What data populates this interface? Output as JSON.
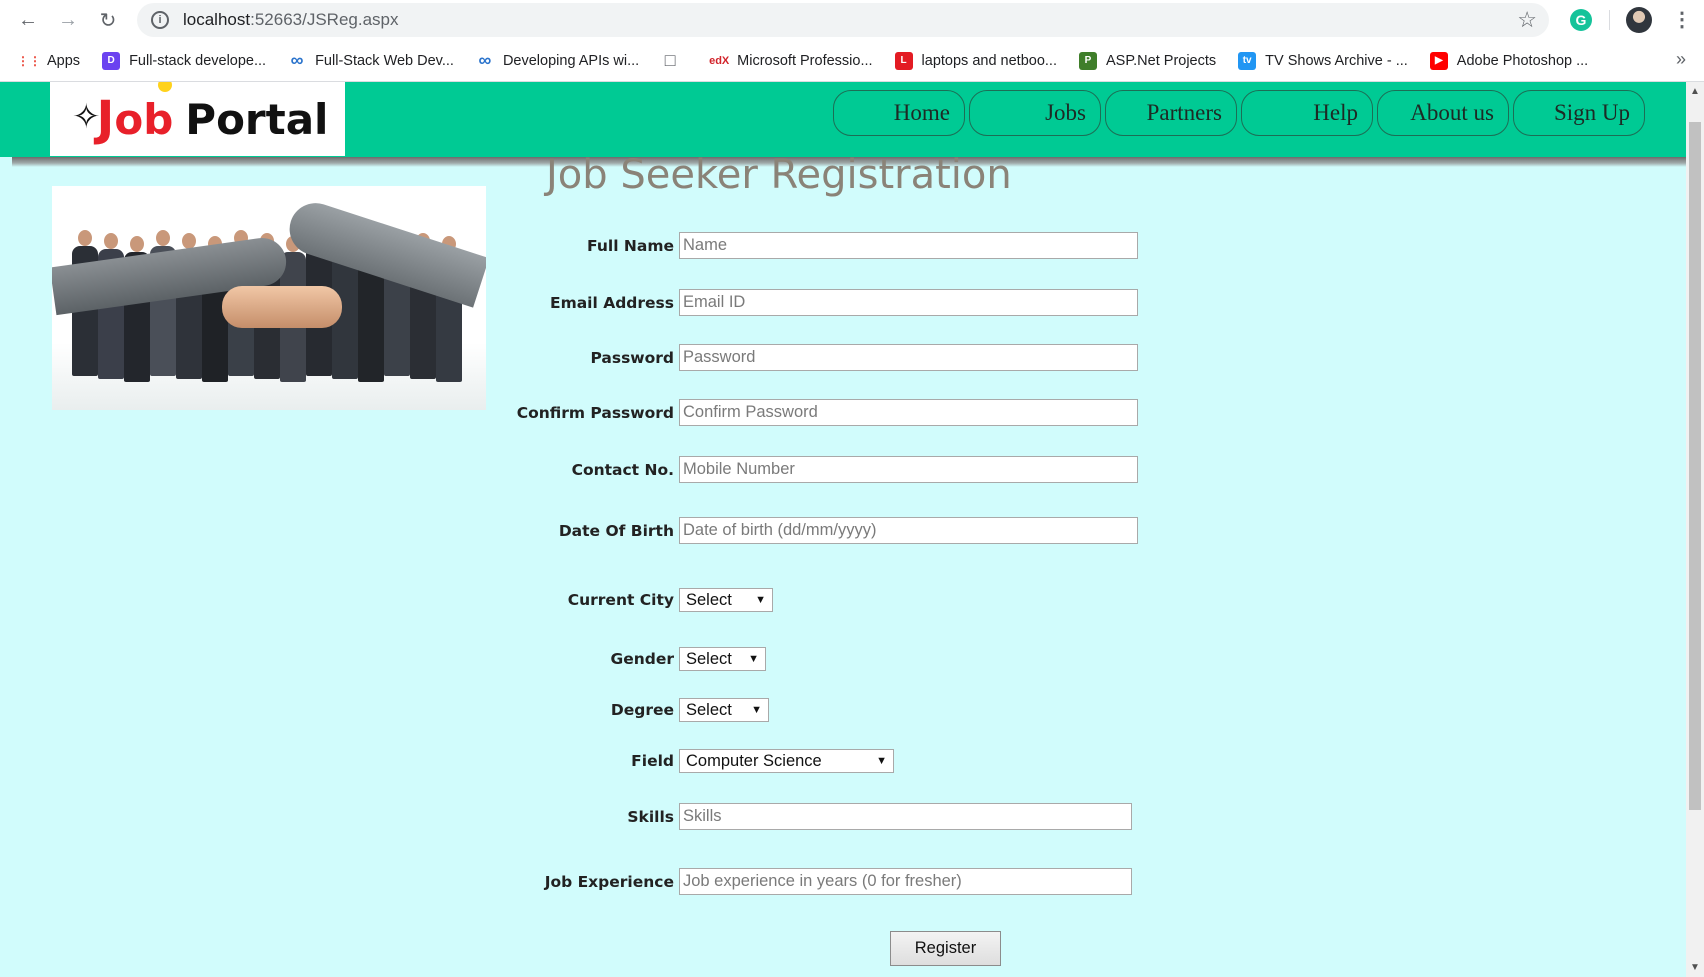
{
  "browser": {
    "url_host": "localhost",
    "url_rest": ":52663/JSReg.aspx",
    "bookmarks": [
      {
        "label": "Apps",
        "icon": "apps-grid-icon",
        "color": "#ea4335"
      },
      {
        "label": "Full-stack develope...",
        "icon": "d-logo-icon",
        "color": "#6b42f0"
      },
      {
        "label": "Full-Stack Web Dev...",
        "icon": "coursera-icon",
        "color": "#2a73cc"
      },
      {
        "label": "Developing APIs wi...",
        "icon": "coursera-icon",
        "color": "#2a73cc"
      },
      {
        "label": "",
        "icon": "page-icon",
        "color": "#ffffff"
      },
      {
        "label": "Microsoft Professio...",
        "icon": "edx-icon",
        "color": "#ffffff"
      },
      {
        "label": "laptops and netboo...",
        "icon": "l-logo-icon",
        "color": "#e31b23"
      },
      {
        "label": "ASP.Net Projects",
        "icon": "p-logo-icon",
        "color": "#3f7e2a"
      },
      {
        "label": "TV Shows Archive - ...",
        "icon": "tv-icon",
        "color": "#2196f3"
      },
      {
        "label": "Adobe Photoshop ...",
        "icon": "youtube-icon",
        "color": "#ff0000"
      }
    ],
    "more": "»"
  },
  "site": {
    "logo_j": "J",
    "logo_ob": "ob",
    "logo_portal": "Portal",
    "nav": [
      "Home",
      "Jobs",
      "Partners",
      "Help",
      "About us",
      "Sign Up"
    ]
  },
  "form": {
    "title": "Job Seeker Registration",
    "fields": [
      {
        "label": "Full Name",
        "placeholder": "Name"
      },
      {
        "label": "Email Address",
        "placeholder": "Email ID"
      },
      {
        "label": "Password",
        "placeholder": "Password"
      },
      {
        "label": "Confirm Password",
        "placeholder": "Confirm Password"
      },
      {
        "label": "Contact No.",
        "placeholder": "Mobile Number"
      },
      {
        "label": "Date Of Birth",
        "placeholder": "Date of birth (dd/mm/yyyy)"
      }
    ],
    "selects": [
      {
        "label": "Current City",
        "value": "Select"
      },
      {
        "label": "Gender",
        "value": "Select"
      },
      {
        "label": "Degree",
        "value": "Select"
      },
      {
        "label": "Field",
        "value": "Computer Science"
      }
    ],
    "skills": {
      "label": "Skills",
      "placeholder": "Skills"
    },
    "experience": {
      "label": "Job Experience",
      "placeholder": "Job experience in years (0 for fresher)"
    },
    "register_label": "Register"
  }
}
